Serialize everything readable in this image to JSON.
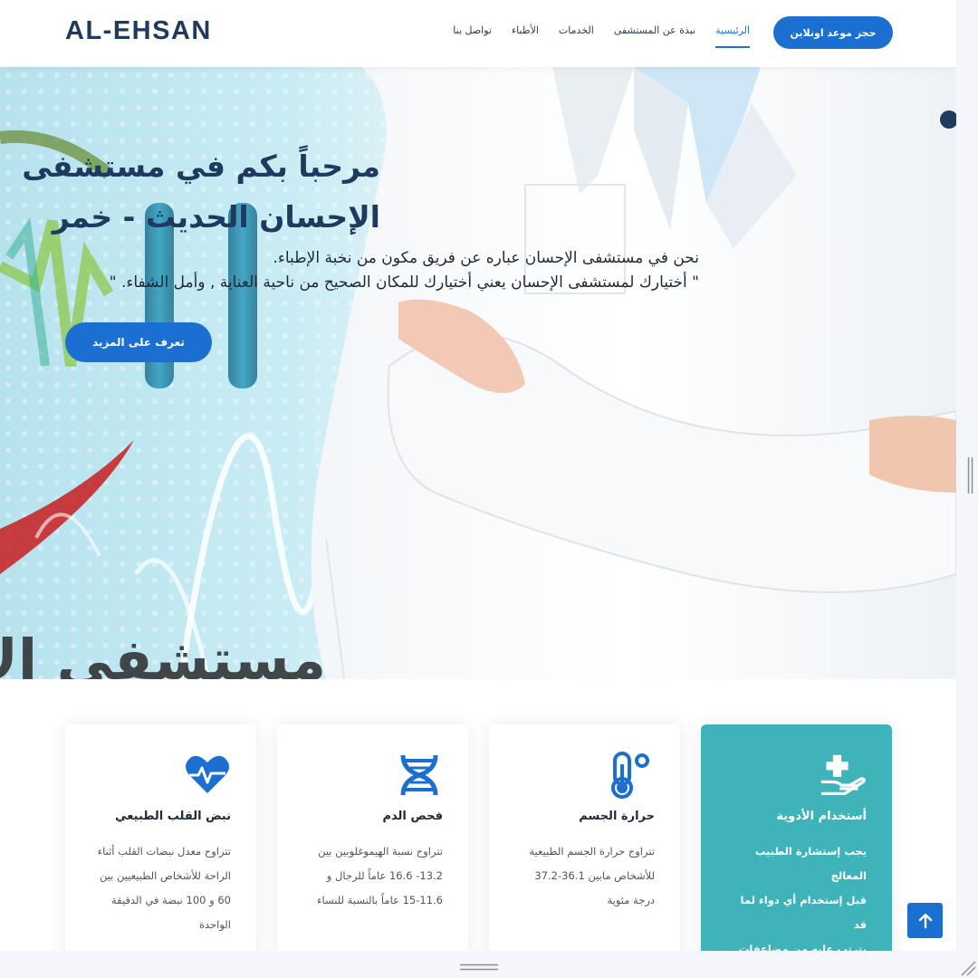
{
  "brand": {
    "logo": "AL-EHSAN"
  },
  "nav": {
    "items": [
      "الرئيسية",
      "نبذة عن المستشفى",
      "الخدمات",
      "الأطباء",
      "تواصل بنا"
    ],
    "active_index": 0,
    "book_button": "حجز موعد اونلاين"
  },
  "hero": {
    "title_line1": "مرحباً بكم في مستشفى",
    "title_line2": "الإحسان الحديث - خمر",
    "desc_line1": "نحن في مستشفى الإحسان عباره عن فريق مكون من نخبة الإطباء.",
    "desc_line2": "\" أختيارك لمستشفى الإحسان يعني أختيارك للمكان الصحيح من ناحية العناية , وأمل الشفاء. \"",
    "more_button": "تعرف على المزيد",
    "bg_watermark": "مستشفى الإ"
  },
  "cards": [
    {
      "icon": "heart-pulse-icon",
      "title": "نبض القلب الطبيعي",
      "lines": [
        "تتراوح معدل نبضات القلب أثناء",
        "الراحة للأشخاص الطبيعيين بين",
        "60 و 100 نبضة في الدقيقة",
        "الواحدة"
      ]
    },
    {
      "icon": "dna-icon",
      "title": "فحص الدم",
      "lines": [
        "تتراوح نسبة الهيموغلوبين بين",
        "13.2- 16.6 عاماً للرجال و",
        "15-11.6 عاماً بالنسبة للنساء"
      ]
    },
    {
      "icon": "thermometer-icon",
      "title": "حرارة الجسم",
      "lines": [
        "تتراوح حرارة الجسم الطبيعية",
        "للأشخاص مابين 36.1-37.2",
        "درجة مئوية"
      ]
    },
    {
      "icon": "hand-medical-icon",
      "title": "أستخدام الأدوية",
      "lines": [
        "يجب إستشارة الطبيب المعالج",
        "قبل إستخدام أي دواء لما قد",
        "يترتب عليه من مضاعفات"
      ],
      "highlight": true
    }
  ],
  "colors": {
    "primary": "#1a6fd1",
    "dark": "#1e3a5f",
    "teal": "#3eb3ba"
  }
}
